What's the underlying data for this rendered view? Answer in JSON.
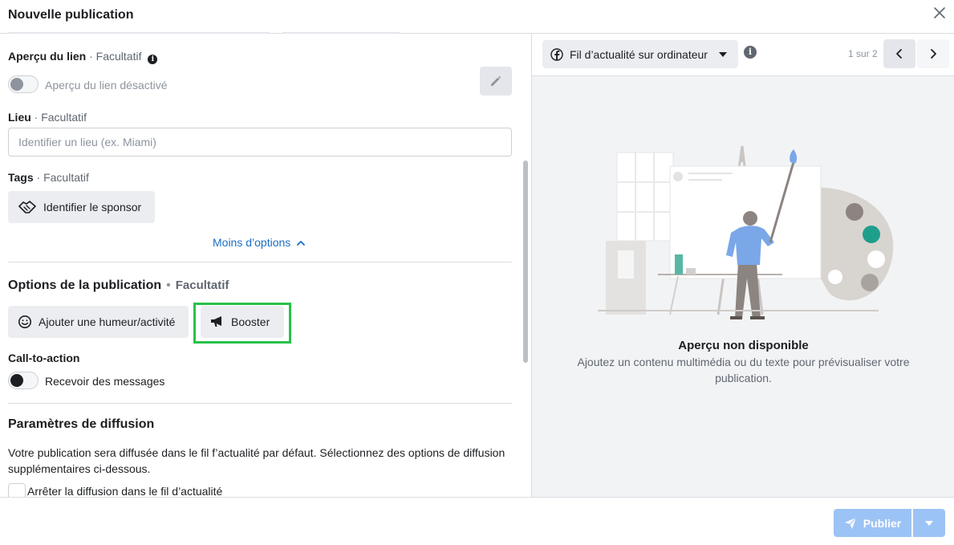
{
  "header": {
    "title": "Nouvelle publication",
    "close_icon": "close-icon"
  },
  "link_preview": {
    "label": "Aperçu du lien",
    "optional": "· Facultatif",
    "toggle_label": "Aperçu du lien désactivé",
    "toggle_on": false
  },
  "location": {
    "label": "Lieu",
    "optional": "· Facultatif",
    "placeholder": "Identifier un lieu (ex. Miami)"
  },
  "tags": {
    "label": "Tags",
    "optional": "· Facultatif",
    "sponsor_button": "Identifier le sponsor"
  },
  "less_options": "Moins d’options",
  "post_options": {
    "title": "Options de la publication",
    "optional": "Facultatif",
    "feeling_button": "Ajouter une humeur/activité",
    "boost_button": "Booster"
  },
  "cta": {
    "label": "Call-to-action",
    "toggle_label": "Recevoir des messages",
    "toggle_on": false
  },
  "distribution": {
    "title": "Paramètres de diffusion",
    "description": "Votre publication sera diffusée dans le fil f’actualité par défaut. Sélectionnez des options de diffusion supplémentaires ci-dessous.",
    "checkbox_label": "Arrêter la diffusion dans le fil d’actualité",
    "checked": false
  },
  "preview": {
    "placement": "Fil d’actualité sur ordinateur",
    "pager": "1 sur 2",
    "empty_title": "Aperçu non disponible",
    "empty_desc": "Ajoutez un contenu multimédia ou du texte pour prévisualiser votre publication."
  },
  "footer": {
    "publish": "Publier"
  },
  "colors": {
    "link": "#1a6ec4",
    "highlight": "#27c24a",
    "publish_disabled": "#9cc3f5"
  }
}
